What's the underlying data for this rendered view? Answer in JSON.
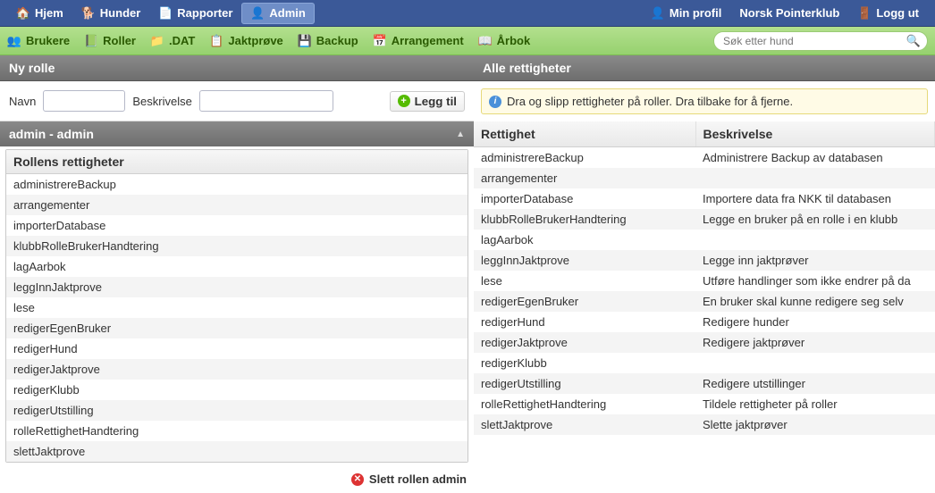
{
  "topnav": {
    "left": [
      {
        "label": "Hjem",
        "icon": "home-icon"
      },
      {
        "label": "Hunder",
        "icon": "dog-icon"
      },
      {
        "label": "Rapporter",
        "icon": "report-icon"
      },
      {
        "label": "Admin",
        "icon": "admin-icon",
        "active": true
      }
    ],
    "right": [
      {
        "label": "Min profil",
        "icon": "profile-icon"
      },
      {
        "label": "Norsk Pointerklub",
        "icon": null
      },
      {
        "label": "Logg ut",
        "icon": "logout-icon"
      }
    ]
  },
  "subnav": {
    "items": [
      {
        "label": "Brukere",
        "icon": "users-icon"
      },
      {
        "label": "Roller",
        "icon": "roles-icon"
      },
      {
        "label": ".DAT",
        "icon": "dat-icon"
      },
      {
        "label": "Jaktprøve",
        "icon": "jaktprove-icon"
      },
      {
        "label": "Backup",
        "icon": "backup-icon"
      },
      {
        "label": "Arrangement",
        "icon": "arrangement-icon"
      },
      {
        "label": "Årbok",
        "icon": "arbok-icon"
      }
    ],
    "search_placeholder": "Søk etter hund"
  },
  "left_panel": {
    "title": "Ny rolle",
    "name_label": "Navn",
    "name_value": "",
    "desc_label": "Beskrivelse",
    "desc_value": "",
    "add_button": "Legg til",
    "section_title": "admin - admin",
    "box_title": "Rollens rettigheter",
    "rights": [
      "administrereBackup",
      "arrangementer",
      "importerDatabase",
      "klubbRolleBrukerHandtering",
      "lagAarbok",
      "leggInnJaktprove",
      "lese",
      "redigerEgenBruker",
      "redigerHund",
      "redigerJaktprove",
      "redigerKlubb",
      "redigerUtstilling",
      "rolleRettighetHandtering",
      "slettJaktprove"
    ],
    "delete_button": "Slett rollen admin"
  },
  "right_panel": {
    "title": "Alle rettigheter",
    "info": "Dra og slipp rettigheter på roller. Dra tilbake for å fjerne.",
    "col_rettighet": "Rettighet",
    "col_beskrivelse": "Beskrivelse",
    "rows": [
      {
        "r": "administrereBackup",
        "b": "Administrere Backup av databasen"
      },
      {
        "r": "arrangementer",
        "b": ""
      },
      {
        "r": "importerDatabase",
        "b": "Importere data fra NKK til databasen"
      },
      {
        "r": "klubbRolleBrukerHandtering",
        "b": "Legge en bruker på en rolle i en klubb"
      },
      {
        "r": "lagAarbok",
        "b": ""
      },
      {
        "r": "leggInnJaktprove",
        "b": "Legge inn jaktprøver"
      },
      {
        "r": "lese",
        "b": "Utføre handlinger som ikke endrer på da"
      },
      {
        "r": "redigerEgenBruker",
        "b": "En bruker skal kunne redigere seg selv"
      },
      {
        "r": "redigerHund",
        "b": "Redigere hunder"
      },
      {
        "r": "redigerJaktprove",
        "b": "Redigere jaktprøver"
      },
      {
        "r": "redigerKlubb",
        "b": ""
      },
      {
        "r": "redigerUtstilling",
        "b": "Redigere utstillinger"
      },
      {
        "r": "rolleRettighetHandtering",
        "b": "Tildele rettigheter på roller"
      },
      {
        "r": "slettJaktprove",
        "b": "Slette jaktprøver"
      }
    ]
  }
}
